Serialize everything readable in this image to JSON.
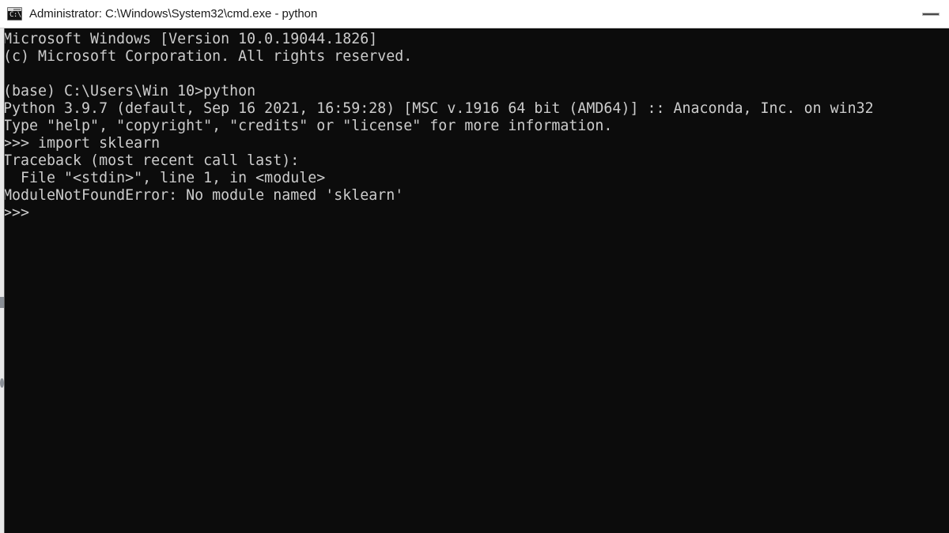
{
  "window": {
    "title": "Administrator: C:\\Windows\\System32\\cmd.exe - python",
    "icon_name": "cmd-console-icon",
    "icon_glyph": "C:\\.",
    "titlebar_background": "#ffffff",
    "titlebar_text_color": "#1b1b1b",
    "buttons": [
      {
        "name": "minimize",
        "label": "Minimize",
        "glyph": "—"
      }
    ]
  },
  "console": {
    "background": "#0c0c0c",
    "foreground": "#cccccc",
    "lines": [
      "Microsoft Windows [Version 10.0.19044.1826]",
      "(c) Microsoft Corporation. All rights reserved.",
      "",
      "(base) C:\\Users\\Win 10>python",
      "Python 3.9.7 (default, Sep 16 2021, 16:59:28) [MSC v.1916 64 bit (AMD64)] :: Anaconda, Inc. on win32",
      "Type \"help\", \"copyright\", \"credits\" or \"license\" for more information.",
      ">>> import sklearn",
      "Traceback (most recent call last):",
      "  File \"<stdin>\", line 1, in <module>",
      "ModuleNotFoundError: No module named 'sklearn'",
      ">>>"
    ],
    "text": "Microsoft Windows [Version 10.0.19044.1826]\n(c) Microsoft Corporation. All rights reserved.\n\n(base) C:\\Users\\Win 10>python\nPython 3.9.7 (default, Sep 16 2021, 16:59:28) [MSC v.1916 64 bit (AMD64)] :: Anaconda, Inc. on win32\nType \"help\", \"copyright\", \"credits\" or \"license\" for more information.\n>>> import sklearn\nTraceback (most recent call last):\n  File \"<stdin>\", line 1, in <module>\nModuleNotFoundError: No module named 'sklearn'\n>>>",
    "prompt": ">>>",
    "command_entered": "import sklearn",
    "error": {
      "type": "ModuleNotFoundError",
      "message": "No module named 'sklearn'"
    }
  }
}
